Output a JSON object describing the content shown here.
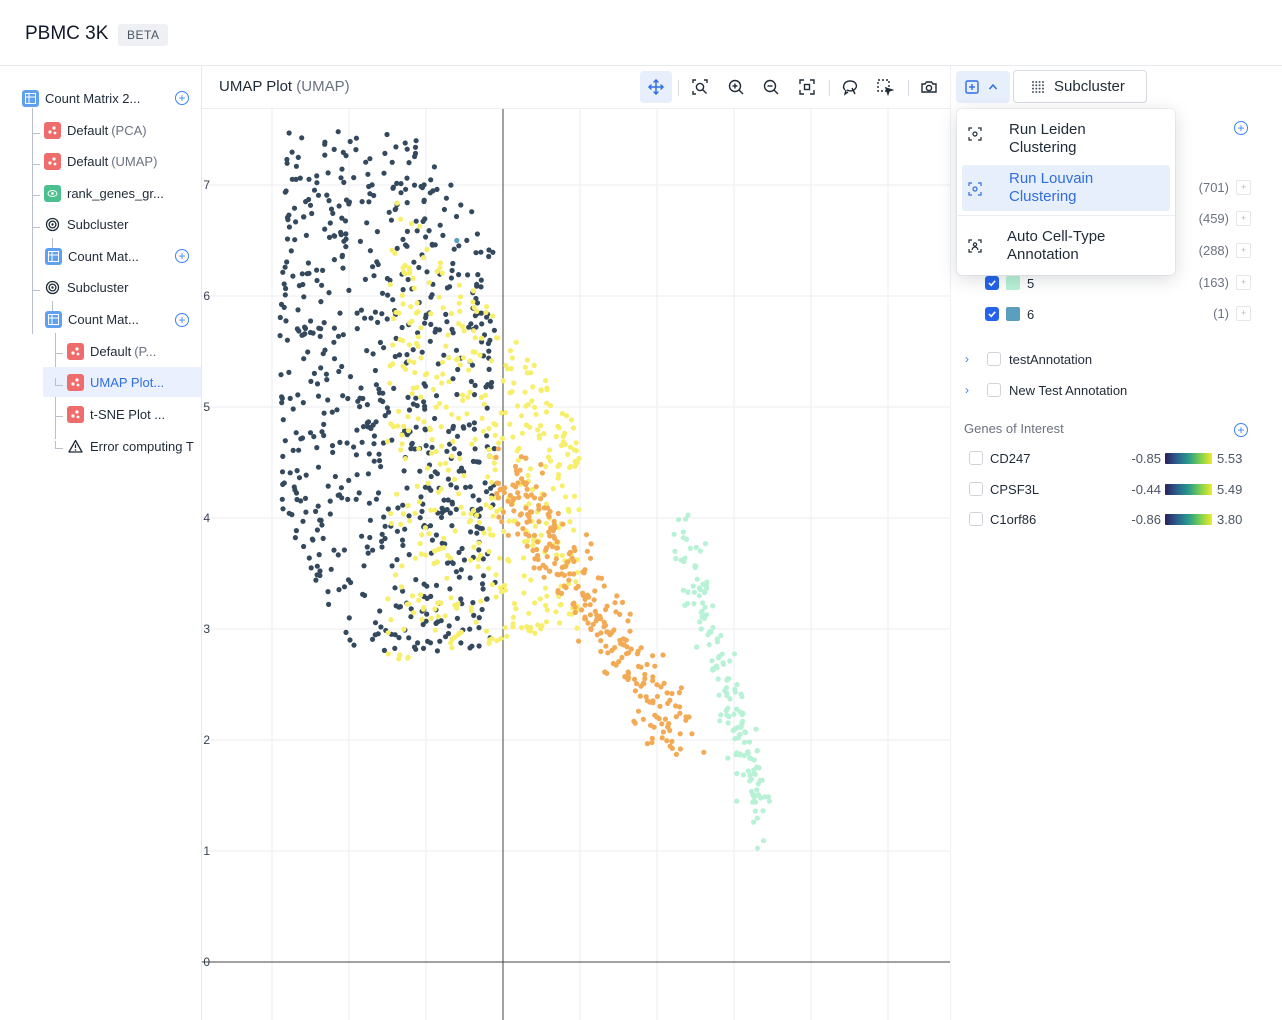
{
  "app": {
    "title": "PBMC 3K",
    "badge": "BETA"
  },
  "sidebar": {
    "items": [
      {
        "label": "Count Matrix 2...",
        "suffix": "",
        "icon": "table-icon"
      },
      {
        "label": "Default",
        "suffix": "(PCA)",
        "icon": "scatter-icon"
      },
      {
        "label": "Default",
        "suffix": "(UMAP)",
        "icon": "scatter-icon"
      },
      {
        "label": "rank_genes_gr...",
        "suffix": "",
        "icon": "eye-icon"
      },
      {
        "label": "Subcluster",
        "suffix": "",
        "icon": "target-icon"
      },
      {
        "label": "Count Mat...",
        "suffix": "",
        "icon": "table-icon"
      },
      {
        "label": "Subcluster",
        "suffix": "",
        "icon": "target-icon"
      },
      {
        "label": "Count Mat...",
        "suffix": "",
        "icon": "table-icon"
      },
      {
        "label": "Default",
        "suffix": "(P...",
        "icon": "scatter-icon"
      },
      {
        "label": "UMAP Plot...",
        "suffix": "",
        "icon": "scatter-icon"
      },
      {
        "label": "t-SNE Plot ...",
        "suffix": "",
        "icon": "scatter-icon"
      },
      {
        "label": "Error computing T",
        "suffix": "",
        "icon": "warning-icon"
      }
    ]
  },
  "plot": {
    "title": "UMAP Plot",
    "subtitle": "(UMAP)",
    "toolbar": [
      "pan-icon",
      "zoom-box-icon",
      "zoom-in-icon",
      "zoom-out-icon",
      "autoscale-icon",
      "lasso-icon",
      "box-select-icon",
      "camera-icon"
    ]
  },
  "actions": {
    "subcluster_label": "Subcluster",
    "menu": [
      {
        "label": "Run Leiden Clustering",
        "line1": "Run Leiden",
        "line2": "Clustering"
      },
      {
        "label": "Run Louvain Clustering",
        "line1": "Run Louvain",
        "line2": "Clustering"
      },
      {
        "label": "Auto Cell-Type Annotation",
        "line1": "Auto Cell-Type",
        "line2": "Annotation"
      }
    ]
  },
  "clusters": [
    {
      "count": "(701)",
      "color": "#34495e"
    },
    {
      "count": "(459)",
      "color": "#f7ef6b"
    },
    {
      "count": "(288)",
      "color": "#f3aa55"
    },
    {
      "name": "5",
      "count": "(163)",
      "color": "#b7f2d6"
    },
    {
      "name": "6",
      "count": "(1)",
      "color": "#5b9fbf"
    }
  ],
  "annotations": [
    {
      "name": "testAnnotation"
    },
    {
      "name": "New Test Annotation"
    }
  ],
  "genes_of_interest": {
    "title": "Genes of Interest",
    "genes": [
      {
        "name": "CD247",
        "min": "-0.85",
        "max": "5.53"
      },
      {
        "name": "CPSF3L",
        "min": "-0.44",
        "max": "5.49"
      },
      {
        "name": "C1orf86",
        "min": "-0.86",
        "max": "3.80"
      }
    ]
  },
  "chart_data": {
    "type": "scatter",
    "title": "",
    "xlabel": "",
    "ylabel": "",
    "ylim": [
      0,
      7.5
    ],
    "x_ticks": [],
    "y_ticks": [
      0,
      1,
      2,
      3,
      4,
      5,
      6,
      7
    ],
    "grid": true,
    "series": [
      {
        "color": "#34495e",
        "x_range": [
          -2.9,
          -0.1
        ],
        "y_range": [
          2.8,
          7.5
        ],
        "count": 701
      },
      {
        "color": "#f7ef6b",
        "x_range": [
          -1.5,
          1.0
        ],
        "y_range": [
          2.3,
          7.0
        ],
        "count": 459
      },
      {
        "color": "#f3aa55",
        "x_range": [
          0.0,
          2.3
        ],
        "y_range": [
          2.0,
          4.4
        ],
        "count": 288
      },
      {
        "color": "#b7f2d6",
        "x_range": [
          2.3,
          3.4
        ],
        "y_range": [
          1.3,
          3.9
        ],
        "count": 163
      },
      {
        "color": "#5b9fbf",
        "x_range": [
          -0.6,
          -0.6
        ],
        "y_range": [
          6.5,
          6.5
        ],
        "count": 1
      }
    ]
  }
}
